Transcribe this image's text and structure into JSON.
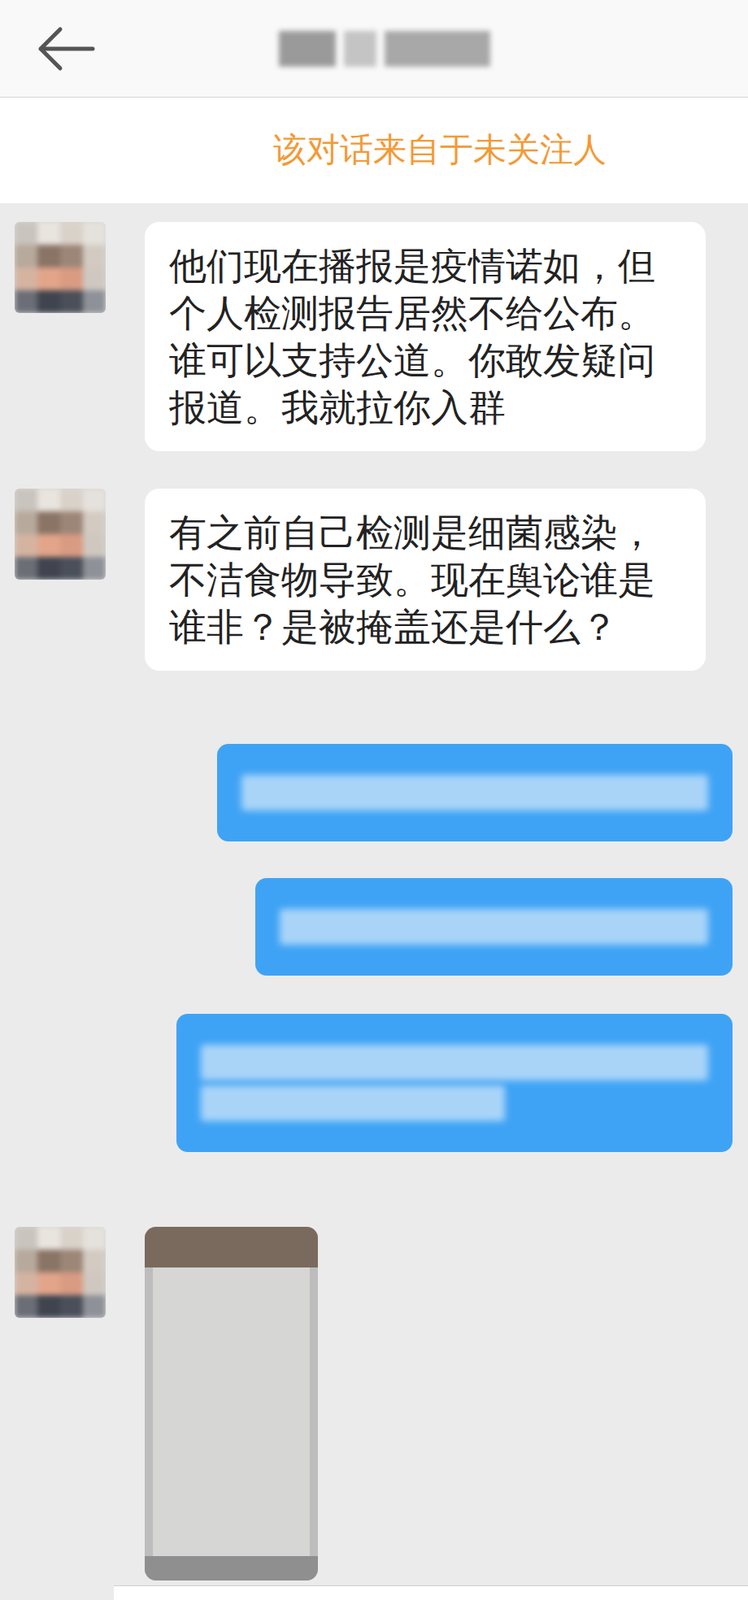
{
  "header": {
    "title_redacted": true
  },
  "notice": "该对话来自于未关注人",
  "messages": [
    {
      "side": "left",
      "kind": "text",
      "avatar_redacted": true,
      "text": "他们现在播报是疫情诺如，但个人检测报告居然不给公布。谁可以支持公道。你敢发疑问报道。我就拉你入群"
    },
    {
      "side": "left",
      "kind": "text",
      "avatar_redacted": true,
      "text": "有之前自己检测是细菌感染，不洁食物导致。现在舆论谁是谁非？是被掩盖还是什么？"
    },
    {
      "side": "right",
      "kind": "redacted",
      "lines": 1
    },
    {
      "side": "right",
      "kind": "redacted",
      "lines": 1
    },
    {
      "side": "right",
      "kind": "redacted",
      "lines": 2
    },
    {
      "side": "left",
      "kind": "photo",
      "avatar_redacted": true
    }
  ]
}
